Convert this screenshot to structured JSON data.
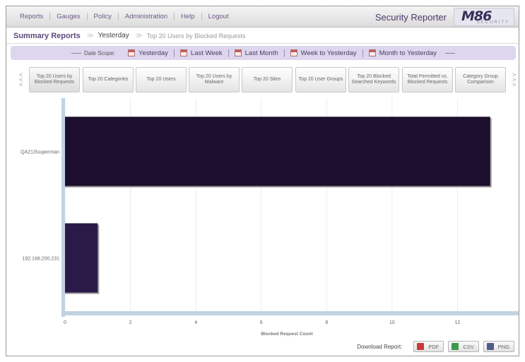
{
  "nav": {
    "items": [
      "Reports",
      "Gauges",
      "Policy",
      "Administration",
      "Help",
      "Logout"
    ],
    "app_title": "Security Reporter",
    "logo_text": "M86",
    "logo_sub": "SECURITY"
  },
  "breadcrumb": {
    "root": "Summary Reports",
    "scope": "Yesterday",
    "current": "Top 20 Users by Blocked Requests"
  },
  "date_scope": {
    "label": "Date Scope:",
    "options": [
      "Yesterday",
      "Last Week",
      "Last Month",
      "Week to Yesterday",
      "Month to Yesterday"
    ]
  },
  "report_tabs": [
    "Top 20 Users by Blocked Requests",
    "Top 20 Categories",
    "Top 20 Users",
    "Top 20 Users by Malware",
    "Top 20 Sites",
    "Top 20 User Groups",
    "Top 20 Blocked Searched Keywords",
    "Total Permitted vs. Blocked Requests",
    "Category Group Comparison"
  ],
  "chart_data": {
    "type": "bar",
    "orientation": "horizontal",
    "categories": [
      "QA213\\superman",
      "192.168.200.231"
    ],
    "values": [
      13,
      1
    ],
    "xlabel": "Blocked Request Count",
    "ylabel": "",
    "xlim": [
      0,
      14
    ],
    "xticks": [
      0,
      2,
      4,
      6,
      8,
      10,
      12,
      14
    ],
    "grid": true,
    "colors": [
      "#1e0f2e",
      "#2a1a48"
    ]
  },
  "download": {
    "label": "Download Report:",
    "formats": [
      "PDF",
      "CSV",
      "PNG"
    ]
  }
}
